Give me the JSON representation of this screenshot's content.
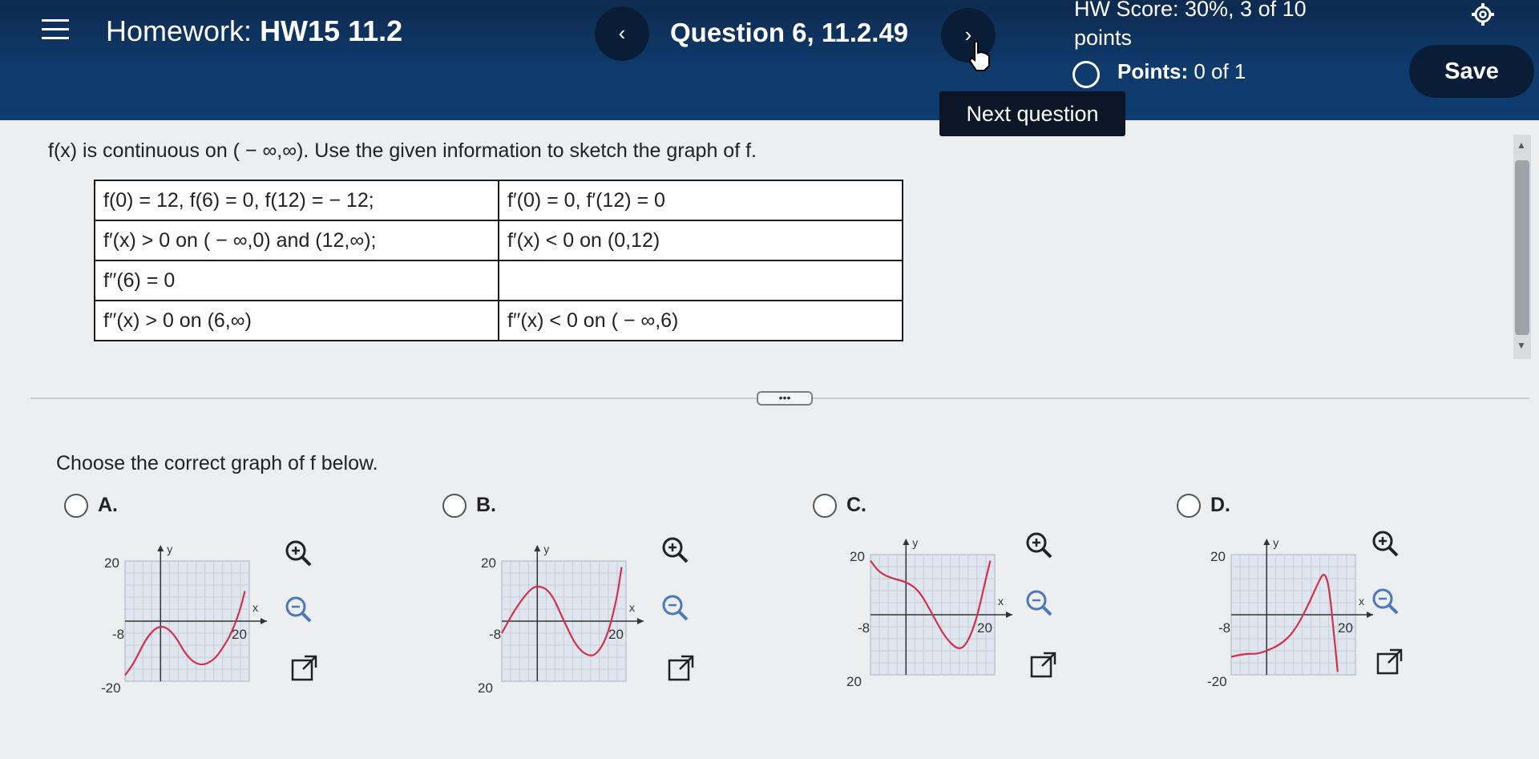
{
  "header": {
    "homework_label": "Homework:",
    "homework_name": "HW15 11.2",
    "prev_label": "‹",
    "question_title": "Question 6, 11.2.49",
    "next_label": "›",
    "hw_score": "HW Score: 30%, 3 of 10",
    "hw_score_unit": "points",
    "points_label": "Points:",
    "points_value": "0 of 1",
    "save_label": "Save",
    "next_tooltip": "Next question"
  },
  "problem": {
    "prompt": "f(x) is continuous on ( − ∞,∞). Use the given information to sketch the graph of f.",
    "table": [
      [
        "f(0) = 12, f(6) = 0, f(12) = − 12;",
        "f′(0) = 0, f′(12) = 0"
      ],
      [
        "f′(x) > 0 on ( − ∞,0) and (12,∞);",
        "f′(x) < 0 on (0,12)"
      ],
      [
        "f′′(6) = 0",
        ""
      ],
      [
        "f′′(x) > 0 on (6,∞)",
        "f′′(x) < 0 on ( − ∞,6)"
      ]
    ],
    "more_label": "•••",
    "choose_prompt": "Choose the correct graph of f below."
  },
  "options": [
    {
      "label": "A.",
      "y_top": "20",
      "y_bottom": "-20",
      "x_left": "-8",
      "x_right": "20",
      "x_axis": "x",
      "y_axis": "y",
      "curve_x": [
        -8,
        -6,
        -3,
        0,
        3,
        6,
        9,
        12,
        14,
        16,
        18,
        19
      ],
      "curve_y": [
        -18,
        -14,
        -5,
        -1,
        -4,
        -12,
        -15,
        -13,
        -9,
        -4,
        4,
        10
      ]
    },
    {
      "label": "B.",
      "y_top": "20",
      "y_bottom": "20",
      "x_left": "-8",
      "x_right": "20",
      "x_axis": "x",
      "y_axis": "y",
      "curve_x": [
        -8,
        -5,
        -2,
        0,
        3,
        6,
        9,
        12,
        14,
        16,
        18,
        19
      ],
      "curve_y": [
        -4,
        4,
        10,
        12,
        10,
        0,
        -9,
        -12,
        -10,
        -4,
        8,
        18
      ]
    },
    {
      "label": "C.",
      "y_top": "20",
      "y_bottom": "20",
      "x_left": "-8",
      "x_right": "20",
      "x_axis": "x",
      "y_axis": "y",
      "curve_x": [
        -8,
        -6,
        -3,
        0,
        3,
        6,
        9,
        12,
        14,
        16,
        18,
        19
      ],
      "curve_y": [
        18,
        14,
        12,
        11,
        8,
        0,
        -8,
        -12,
        -9,
        -1,
        12,
        18
      ]
    },
    {
      "label": "D.",
      "y_top": "20",
      "y_bottom": "-20",
      "x_left": "-8",
      "x_right": "20",
      "x_axis": "x",
      "y_axis": "y",
      "curve_x": [
        -8,
        -5,
        -2,
        0,
        3,
        6,
        9,
        12,
        13,
        14,
        15,
        16
      ],
      "curve_y": [
        -14,
        -13,
        -13,
        -12,
        -10,
        -6,
        2,
        12,
        14,
        10,
        -4,
        -19
      ]
    }
  ],
  "colors": {
    "header_bg": "#0f3a6b",
    "curve": "#d1314a",
    "grid": "#c8cdd6",
    "plot_bg": "#dfe6ef"
  }
}
